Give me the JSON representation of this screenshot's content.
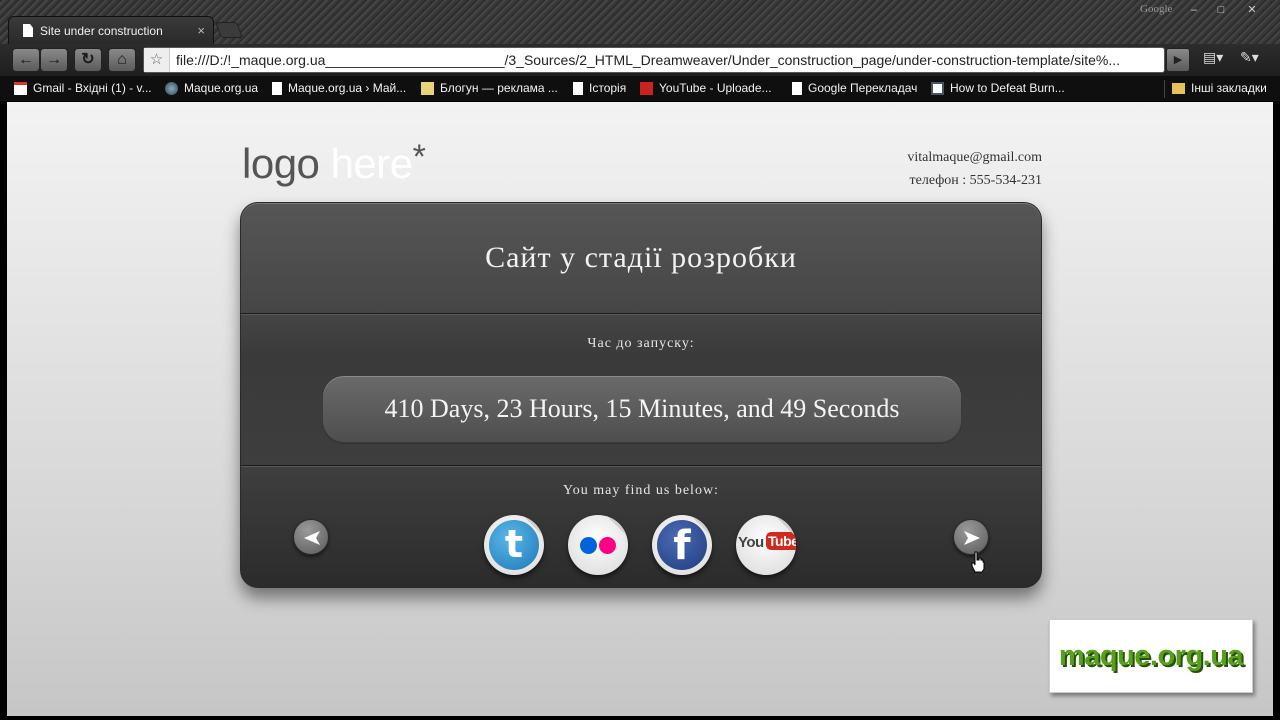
{
  "browser": {
    "tab_title": "Site under construction",
    "google_mark": "Google",
    "url": "file:///D:/!_maque.org.ua_______________________/3_Sources/2_HTML_Dreamweaver/Under_construction_page/under-construction-template/site%...",
    "bookmarks": [
      {
        "label": "Gmail - Вхідні (1) - v...",
        "icon": "gmail-icon"
      },
      {
        "label": "Maque.org.ua",
        "icon": "globe-icon"
      },
      {
        "label": "Maque.org.ua › Май...",
        "icon": "page-icon"
      },
      {
        "label": "Блогун — реклама ...",
        "icon": "blogun-icon"
      },
      {
        "label": "Історія",
        "icon": "page-icon"
      },
      {
        "label": "YouTube - Uploade...",
        "icon": "youtube-icon"
      },
      {
        "label": "Google Перекладач",
        "icon": "page-icon"
      },
      {
        "label": "How to Defeat Burn...",
        "icon": "site-icon"
      }
    ],
    "other_bookmarks": "Інші закладки"
  },
  "page": {
    "logo_left": "logo",
    "logo_right": "here",
    "logo_mark": "*",
    "email": "vitalmaque@gmail.com",
    "phone": "телефон : 555-534-231",
    "title": "Сайт у стадії розробки",
    "countdown_label": "Час до запуску:",
    "countdown_value": "410 Days, 23 Hours, 15 Minutes, and 49 Seconds",
    "social_label": "You may find us below:",
    "social_networks": [
      "twitter-icon",
      "flickr-icon",
      "facebook-icon",
      "youtube-icon"
    ],
    "youtube_you": "You",
    "youtube_tube": "Tube",
    "watermark": "maque.org.ua"
  },
  "colors": {
    "panel": "#3e3e3e",
    "watermark_green": "#56a01c",
    "twitter_blue": "#1b78b8",
    "facebook_blue": "#213b7e",
    "flickr_blue": "#0063dc",
    "flickr_pink": "#ff0084"
  }
}
